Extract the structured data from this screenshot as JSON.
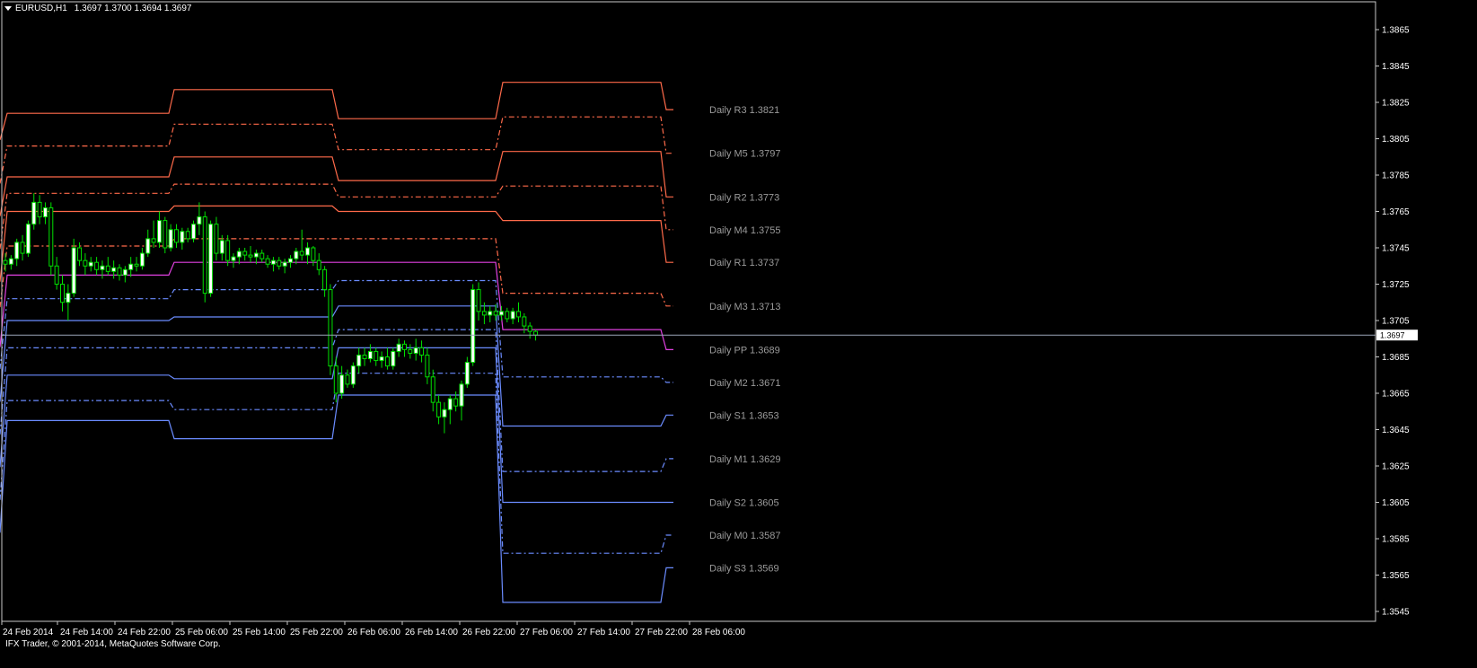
{
  "window": {
    "symbol_title": "EURUSD,H1",
    "ohlc": "1.3697 1.3700 1.3694 1.3697",
    "copyright": "IFX Trader, © 2001-2014, MetaQuotes Software Corp."
  },
  "colors": {
    "background": "#000000",
    "frame": "#c8c8c8",
    "resistance": "#ff6a4a",
    "support": "#6b8cff",
    "pivot": "#e040e0",
    "bull_candle": "#ffffff",
    "bear_candle": "#000000",
    "wick": "#00e000",
    "bid_line": "#9aa4b8",
    "label_text": "#9a9a9a"
  },
  "price_scale": {
    "ticks": [
      "1.3865",
      "1.3845",
      "1.3825",
      "1.3805",
      "1.3785",
      "1.3765",
      "1.3745",
      "1.3725",
      "1.3705",
      "1.3685",
      "1.3665",
      "1.3645",
      "1.3625",
      "1.3605",
      "1.3585",
      "1.3565",
      "1.3545"
    ],
    "current_bid": "1.3697"
  },
  "time_scale": {
    "ticks": [
      "24 Feb 2014",
      "24 Feb 14:00",
      "24 Feb 22:00",
      "25 Feb 06:00",
      "25 Feb 14:00",
      "25 Feb 22:00",
      "26 Feb 06:00",
      "26 Feb 14:00",
      "26 Feb 22:00",
      "27 Feb 06:00",
      "27 Feb 14:00",
      "27 Feb 22:00",
      "28 Feb 06:00"
    ]
  },
  "chart_data": {
    "type": "candlestick",
    "symbol": "EURUSD",
    "timeframe": "H1",
    "ylim": [
      1.354,
      1.3875
    ],
    "current_price": 1.3697,
    "candles": [
      [
        1.3738,
        1.3742,
        1.3732,
        1.3736
      ],
      [
        1.3736,
        1.3741,
        1.3733,
        1.3739
      ],
      [
        1.3739,
        1.375,
        1.3735,
        1.3748
      ],
      [
        1.3748,
        1.3752,
        1.3738,
        1.3742
      ],
      [
        1.3742,
        1.376,
        1.374,
        1.3758
      ],
      [
        1.3758,
        1.3775,
        1.3755,
        1.377
      ],
      [
        1.377,
        1.3774,
        1.3758,
        1.3762
      ],
      [
        1.3762,
        1.377,
        1.3758,
        1.3767
      ],
      [
        1.3767,
        1.377,
        1.373,
        1.3735
      ],
      [
        1.3735,
        1.374,
        1.3722,
        1.3725
      ],
      [
        1.3725,
        1.373,
        1.371,
        1.3715
      ],
      [
        1.3715,
        1.3725,
        1.3705,
        1.372
      ],
      [
        1.372,
        1.375,
        1.3718,
        1.3745
      ],
      [
        1.3745,
        1.3748,
        1.3735,
        1.3738
      ],
      [
        1.3738,
        1.3742,
        1.373,
        1.3735
      ],
      [
        1.3735,
        1.374,
        1.3732,
        1.3737
      ],
      [
        1.3737,
        1.374,
        1.373,
        1.3733
      ],
      [
        1.3733,
        1.3738,
        1.3728,
        1.3735
      ],
      [
        1.3735,
        1.374,
        1.373,
        1.3732
      ],
      [
        1.3732,
        1.3738,
        1.3728,
        1.3734
      ],
      [
        1.3734,
        1.3736,
        1.3727,
        1.373
      ],
      [
        1.373,
        1.3735,
        1.3726,
        1.3733
      ],
      [
        1.3733,
        1.374,
        1.3729,
        1.3736
      ],
      [
        1.3736,
        1.374,
        1.3732,
        1.3735
      ],
      [
        1.3735,
        1.3745,
        1.3733,
        1.3742
      ],
      [
        1.3742,
        1.3755,
        1.374,
        1.375
      ],
      [
        1.375,
        1.376,
        1.3745,
        1.3748
      ],
      [
        1.3748,
        1.3765,
        1.3745,
        1.376
      ],
      [
        1.376,
        1.3762,
        1.3742,
        1.3745
      ],
      [
        1.3745,
        1.3758,
        1.3743,
        1.3755
      ],
      [
        1.3755,
        1.3758,
        1.3745,
        1.3748
      ],
      [
        1.3748,
        1.3756,
        1.3744,
        1.3754
      ],
      [
        1.3754,
        1.3756,
        1.3748,
        1.375
      ],
      [
        1.375,
        1.376,
        1.3748,
        1.3758
      ],
      [
        1.3758,
        1.377,
        1.3752,
        1.3762
      ],
      [
        1.3762,
        1.3765,
        1.3715,
        1.372
      ],
      [
        1.372,
        1.376,
        1.3718,
        1.3758
      ],
      [
        1.3758,
        1.3762,
        1.3738,
        1.3742
      ],
      [
        1.3742,
        1.3752,
        1.3738,
        1.3749
      ],
      [
        1.3749,
        1.3752,
        1.3735,
        1.3738
      ],
      [
        1.3738,
        1.3742,
        1.3734,
        1.374
      ],
      [
        1.374,
        1.3745,
        1.3736,
        1.3743
      ],
      [
        1.3743,
        1.3745,
        1.3738,
        1.3741
      ],
      [
        1.3741,
        1.3746,
        1.3737,
        1.374
      ],
      [
        1.374,
        1.3744,
        1.3736,
        1.3742
      ],
      [
        1.3742,
        1.3744,
        1.3737,
        1.3739
      ],
      [
        1.3739,
        1.3741,
        1.3734,
        1.3736
      ],
      [
        1.3736,
        1.374,
        1.3732,
        1.3738
      ],
      [
        1.3738,
        1.374,
        1.3733,
        1.3735
      ],
      [
        1.3735,
        1.3739,
        1.3731,
        1.3737
      ],
      [
        1.3737,
        1.3741,
        1.3734,
        1.3739
      ],
      [
        1.3739,
        1.3745,
        1.3736,
        1.3743
      ],
      [
        1.3743,
        1.3755,
        1.3738,
        1.3741
      ],
      [
        1.3741,
        1.3748,
        1.3736,
        1.3745
      ],
      [
        1.3745,
        1.3746,
        1.3735,
        1.3738
      ],
      [
        1.3738,
        1.3742,
        1.373,
        1.3733
      ],
      [
        1.3733,
        1.3735,
        1.3718,
        1.3722
      ],
      [
        1.3722,
        1.3725,
        1.3675,
        1.368
      ],
      [
        1.368,
        1.3685,
        1.366,
        1.3665
      ],
      [
        1.3665,
        1.368,
        1.3662,
        1.3675
      ],
      [
        1.3675,
        1.3678,
        1.3668,
        1.367
      ],
      [
        1.367,
        1.3682,
        1.3668,
        1.368
      ],
      [
        1.368,
        1.369,
        1.3676,
        1.3686
      ],
      [
        1.3686,
        1.369,
        1.368,
        1.3684
      ],
      [
        1.3684,
        1.3692,
        1.3682,
        1.3688
      ],
      [
        1.3688,
        1.369,
        1.368,
        1.3683
      ],
      [
        1.3683,
        1.3688,
        1.3679,
        1.3685
      ],
      [
        1.3685,
        1.369,
        1.3678,
        1.368
      ],
      [
        1.368,
        1.369,
        1.3678,
        1.3688
      ],
      [
        1.3688,
        1.3695,
        1.3685,
        1.3692
      ],
      [
        1.3692,
        1.3694,
        1.3685,
        1.3689
      ],
      [
        1.3689,
        1.3692,
        1.3684,
        1.3687
      ],
      [
        1.3687,
        1.3695,
        1.3683,
        1.369
      ],
      [
        1.369,
        1.3694,
        1.3682,
        1.3686
      ],
      [
        1.3686,
        1.369,
        1.367,
        1.3674
      ],
      [
        1.3674,
        1.3678,
        1.3655,
        1.366
      ],
      [
        1.366,
        1.3664,
        1.3648,
        1.3652
      ],
      [
        1.3652,
        1.366,
        1.3643,
        1.3656
      ],
      [
        1.3656,
        1.3664,
        1.3648,
        1.3662
      ],
      [
        1.3662,
        1.3666,
        1.3655,
        1.3658
      ],
      [
        1.3658,
        1.3672,
        1.365,
        1.367
      ],
      [
        1.367,
        1.3685,
        1.3668,
        1.3682
      ],
      [
        1.3682,
        1.3725,
        1.368,
        1.3722
      ],
      [
        1.3722,
        1.3726,
        1.3705,
        1.371
      ],
      [
        1.371,
        1.3715,
        1.3703,
        1.3708
      ],
      [
        1.3708,
        1.3713,
        1.3704,
        1.371
      ],
      [
        1.371,
        1.3714,
        1.3705,
        1.3708
      ],
      [
        1.3708,
        1.3713,
        1.3705,
        1.371
      ],
      [
        1.371,
        1.3712,
        1.3704,
        1.3706
      ],
      [
        1.3706,
        1.3712,
        1.3703,
        1.371
      ],
      [
        1.371,
        1.3715,
        1.3704,
        1.3707
      ],
      [
        1.3707,
        1.3709,
        1.3698,
        1.3702
      ],
      [
        1.3702,
        1.3704,
        1.3695,
        1.3699
      ],
      [
        1.3699,
        1.37,
        1.3694,
        1.3697
      ]
    ],
    "levels": [
      {
        "name": "Daily R3",
        "value": "1.3821",
        "type": "resistance",
        "style": "solid",
        "path": [
          1.3834,
          1.3819,
          1.3819,
          1.3832,
          1.3832,
          1.3816,
          1.3816,
          1.3836,
          1.3836,
          1.3821
        ]
      },
      {
        "name": "Daily M5",
        "value": "1.3797",
        "type": "resistance",
        "style": "dashdot",
        "path": [
          1.381,
          1.3801,
          1.3801,
          1.3813,
          1.3813,
          1.3799,
          1.3799,
          1.3817,
          1.3817,
          1.3797
        ]
      },
      {
        "name": "Daily R2",
        "value": "1.3773",
        "type": "resistance",
        "style": "solid",
        "path": [
          1.3792,
          1.3784,
          1.3784,
          1.3795,
          1.3795,
          1.3782,
          1.3782,
          1.3798,
          1.3798,
          1.3773
        ]
      },
      {
        "name": "Daily M4",
        "value": "1.3755",
        "type": "resistance",
        "style": "dashdot",
        "path": [
          1.3774,
          1.3775,
          1.3775,
          1.378,
          1.378,
          1.3773,
          1.3773,
          1.3779,
          1.3779,
          1.3755
        ]
      },
      {
        "name": "Daily R1",
        "value": "1.3737",
        "type": "resistance",
        "style": "solid",
        "path": [
          1.3756,
          1.3765,
          1.3765,
          1.3768,
          1.3768,
          1.3765,
          1.3765,
          1.376,
          1.376,
          1.3737
        ]
      },
      {
        "name": "Daily M3",
        "value": "1.3713",
        "type": "resistance",
        "style": "dashdot",
        "path": [
          1.3742,
          1.3746,
          1.3746,
          1.375,
          1.375,
          1.375,
          1.375,
          1.372,
          1.372,
          1.3713
        ]
      },
      {
        "name": "Daily PP",
        "value": "1.3689",
        "type": "pivot",
        "style": "solid",
        "path": [
          1.372,
          1.373,
          1.373,
          1.3737,
          1.3737,
          1.3737,
          1.3737,
          1.37,
          1.37,
          1.3689
        ]
      },
      {
        "name": "Daily M2",
        "value": "1.3671",
        "type": "support",
        "style": "dashdot",
        "path": [
          1.3708,
          1.3717,
          1.3717,
          1.3722,
          1.3722,
          1.3727,
          1.3727,
          1.3674,
          1.3674,
          1.3671
        ]
      },
      {
        "name": "Daily S1",
        "value": "1.3653",
        "type": "support",
        "style": "solid",
        "path": [
          1.369,
          1.3705,
          1.3705,
          1.3707,
          1.3707,
          1.3713,
          1.3713,
          1.3647,
          1.3647,
          1.3653
        ]
      },
      {
        "name": "Daily M1",
        "value": "1.3629",
        "type": "support",
        "style": "dashdot",
        "path": [
          1.3672,
          1.369,
          1.369,
          1.369,
          1.369,
          1.37,
          1.37,
          1.3622,
          1.3622,
          1.3629
        ]
      },
      {
        "name": "Daily S2",
        "value": "1.3605",
        "type": "support",
        "style": "solid",
        "path": [
          1.3654,
          1.3675,
          1.3675,
          1.3673,
          1.3673,
          1.369,
          1.369,
          1.3605,
          1.3605,
          1.3605
        ]
      },
      {
        "name": "Daily M0",
        "value": "1.3587",
        "type": "support",
        "style": "dashdot",
        "path": [
          1.3636,
          1.3661,
          1.3661,
          1.3656,
          1.3656,
          1.3676,
          1.3676,
          1.3577,
          1.3577,
          1.3587
        ]
      },
      {
        "name": "Daily S3",
        "value": "1.3569",
        "type": "support",
        "style": "solid",
        "path": [
          1.3618,
          1.365,
          1.365,
          1.364,
          1.364,
          1.3664,
          1.3664,
          1.355,
          1.355,
          1.3569
        ]
      }
    ]
  }
}
